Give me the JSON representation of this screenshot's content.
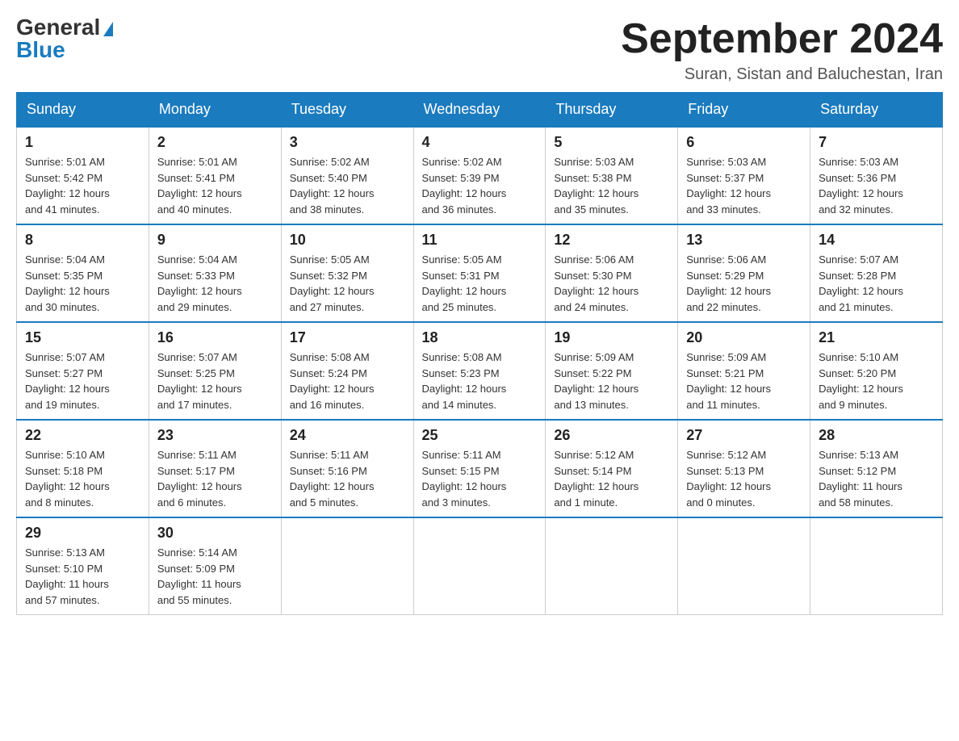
{
  "logo": {
    "general": "General",
    "blue": "Blue"
  },
  "title": "September 2024",
  "location": "Suran, Sistan and Baluchestan, Iran",
  "weekdays": [
    "Sunday",
    "Monday",
    "Tuesday",
    "Wednesday",
    "Thursday",
    "Friday",
    "Saturday"
  ],
  "weeks": [
    [
      {
        "day": "1",
        "sunrise": "5:01 AM",
        "sunset": "5:42 PM",
        "daylight": "12 hours and 41 minutes."
      },
      {
        "day": "2",
        "sunrise": "5:01 AM",
        "sunset": "5:41 PM",
        "daylight": "12 hours and 40 minutes."
      },
      {
        "day": "3",
        "sunrise": "5:02 AM",
        "sunset": "5:40 PM",
        "daylight": "12 hours and 38 minutes."
      },
      {
        "day": "4",
        "sunrise": "5:02 AM",
        "sunset": "5:39 PM",
        "daylight": "12 hours and 36 minutes."
      },
      {
        "day": "5",
        "sunrise": "5:03 AM",
        "sunset": "5:38 PM",
        "daylight": "12 hours and 35 minutes."
      },
      {
        "day": "6",
        "sunrise": "5:03 AM",
        "sunset": "5:37 PM",
        "daylight": "12 hours and 33 minutes."
      },
      {
        "day": "7",
        "sunrise": "5:03 AM",
        "sunset": "5:36 PM",
        "daylight": "12 hours and 32 minutes."
      }
    ],
    [
      {
        "day": "8",
        "sunrise": "5:04 AM",
        "sunset": "5:35 PM",
        "daylight": "12 hours and 30 minutes."
      },
      {
        "day": "9",
        "sunrise": "5:04 AM",
        "sunset": "5:33 PM",
        "daylight": "12 hours and 29 minutes."
      },
      {
        "day": "10",
        "sunrise": "5:05 AM",
        "sunset": "5:32 PM",
        "daylight": "12 hours and 27 minutes."
      },
      {
        "day": "11",
        "sunrise": "5:05 AM",
        "sunset": "5:31 PM",
        "daylight": "12 hours and 25 minutes."
      },
      {
        "day": "12",
        "sunrise": "5:06 AM",
        "sunset": "5:30 PM",
        "daylight": "12 hours and 24 minutes."
      },
      {
        "day": "13",
        "sunrise": "5:06 AM",
        "sunset": "5:29 PM",
        "daylight": "12 hours and 22 minutes."
      },
      {
        "day": "14",
        "sunrise": "5:07 AM",
        "sunset": "5:28 PM",
        "daylight": "12 hours and 21 minutes."
      }
    ],
    [
      {
        "day": "15",
        "sunrise": "5:07 AM",
        "sunset": "5:27 PM",
        "daylight": "12 hours and 19 minutes."
      },
      {
        "day": "16",
        "sunrise": "5:07 AM",
        "sunset": "5:25 PM",
        "daylight": "12 hours and 17 minutes."
      },
      {
        "day": "17",
        "sunrise": "5:08 AM",
        "sunset": "5:24 PM",
        "daylight": "12 hours and 16 minutes."
      },
      {
        "day": "18",
        "sunrise": "5:08 AM",
        "sunset": "5:23 PM",
        "daylight": "12 hours and 14 minutes."
      },
      {
        "day": "19",
        "sunrise": "5:09 AM",
        "sunset": "5:22 PM",
        "daylight": "12 hours and 13 minutes."
      },
      {
        "day": "20",
        "sunrise": "5:09 AM",
        "sunset": "5:21 PM",
        "daylight": "12 hours and 11 minutes."
      },
      {
        "day": "21",
        "sunrise": "5:10 AM",
        "sunset": "5:20 PM",
        "daylight": "12 hours and 9 minutes."
      }
    ],
    [
      {
        "day": "22",
        "sunrise": "5:10 AM",
        "sunset": "5:18 PM",
        "daylight": "12 hours and 8 minutes."
      },
      {
        "day": "23",
        "sunrise": "5:11 AM",
        "sunset": "5:17 PM",
        "daylight": "12 hours and 6 minutes."
      },
      {
        "day": "24",
        "sunrise": "5:11 AM",
        "sunset": "5:16 PM",
        "daylight": "12 hours and 5 minutes."
      },
      {
        "day": "25",
        "sunrise": "5:11 AM",
        "sunset": "5:15 PM",
        "daylight": "12 hours and 3 minutes."
      },
      {
        "day": "26",
        "sunrise": "5:12 AM",
        "sunset": "5:14 PM",
        "daylight": "12 hours and 1 minute."
      },
      {
        "day": "27",
        "sunrise": "5:12 AM",
        "sunset": "5:13 PM",
        "daylight": "12 hours and 0 minutes."
      },
      {
        "day": "28",
        "sunrise": "5:13 AM",
        "sunset": "5:12 PM",
        "daylight": "11 hours and 58 minutes."
      }
    ],
    [
      {
        "day": "29",
        "sunrise": "5:13 AM",
        "sunset": "5:10 PM",
        "daylight": "11 hours and 57 minutes."
      },
      {
        "day": "30",
        "sunrise": "5:14 AM",
        "sunset": "5:09 PM",
        "daylight": "11 hours and 55 minutes."
      },
      null,
      null,
      null,
      null,
      null
    ]
  ]
}
